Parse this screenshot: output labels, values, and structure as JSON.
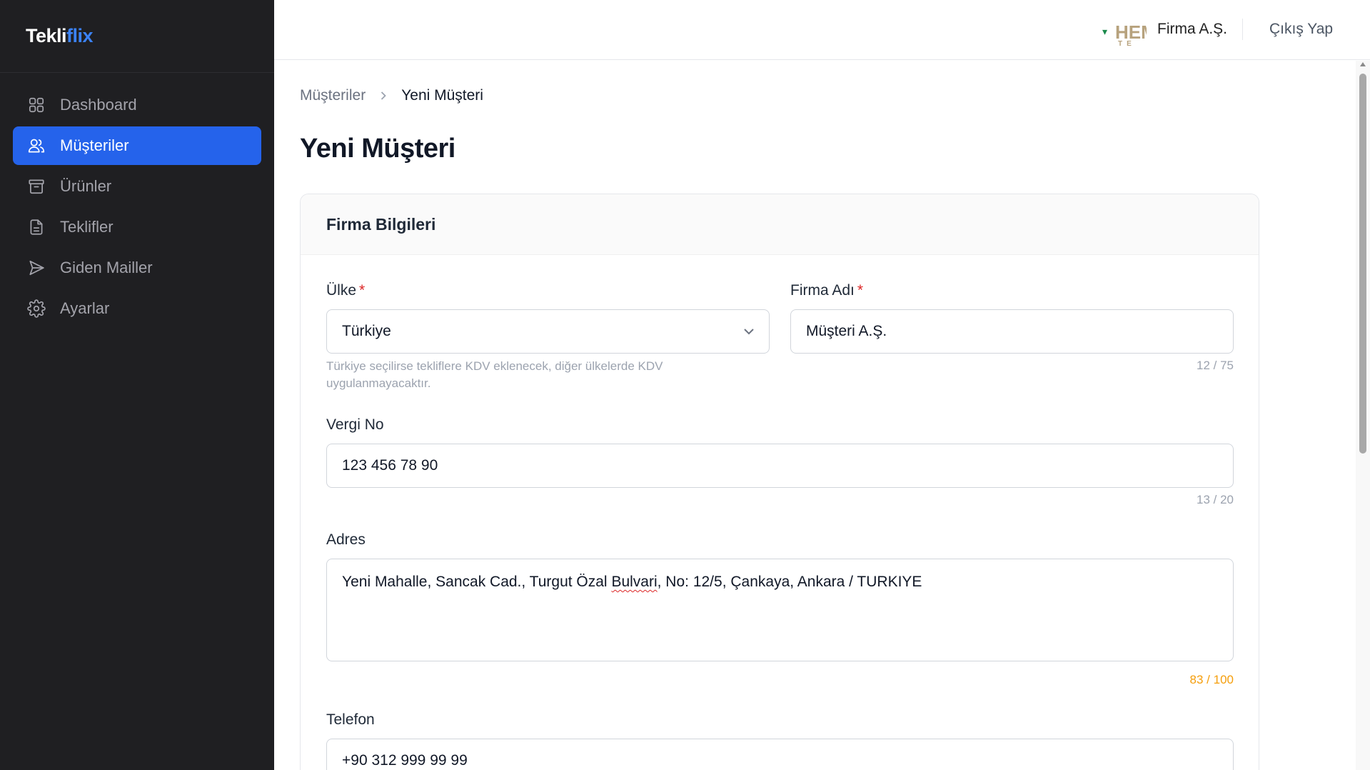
{
  "brand": {
    "part1": "Tekli",
    "part2": "flix"
  },
  "sidebar": {
    "items": [
      {
        "label": "Dashboard",
        "icon": "grid-icon",
        "active": false
      },
      {
        "label": "Müşteriler",
        "icon": "users-icon",
        "active": true
      },
      {
        "label": "Ürünler",
        "icon": "archive-icon",
        "active": false
      },
      {
        "label": "Teklifler",
        "icon": "file-text-icon",
        "active": false
      },
      {
        "label": "Giden Mailler",
        "icon": "send-icon",
        "active": false
      },
      {
        "label": "Ayarlar",
        "icon": "gear-icon",
        "active": false
      }
    ]
  },
  "topbar": {
    "logo_text": "HEM",
    "company_name": "Firma A.Ş.",
    "logout_label": "Çıkış Yap"
  },
  "breadcrumb": {
    "parent": "Müşteriler",
    "current": "Yeni Müşteri"
  },
  "page": {
    "title": "Yeni Müşteri"
  },
  "card": {
    "title": "Firma Bilgileri",
    "country": {
      "label": "Ülke",
      "value": "Türkiye",
      "hint": "Türkiye seçilirse tekliflere KDV eklenecek, diğer ülkelerde KDV uygulanmayacaktır."
    },
    "company": {
      "label": "Firma Adı",
      "value": "Müşteri A.Ş.",
      "counter": "12 / 75"
    },
    "tax": {
      "label": "Vergi No",
      "value": "123 456 78 90",
      "counter": "13 / 20"
    },
    "address": {
      "label": "Adres",
      "value_before": "Yeni Mahalle, Sancak Cad., Turgut Özal ",
      "value_misspelled": "Bulvari",
      "value_after": ", No: 12/5, Çankaya, Ankara / TURKIYE",
      "counter": "83 / 100"
    },
    "phone": {
      "label": "Telefon",
      "value": "+90 312 999 99 99"
    }
  },
  "colors": {
    "accent": "#2563eb",
    "sidebar_bg": "#1f1f22",
    "warning": "#f59e0b",
    "required": "#dc2626"
  }
}
